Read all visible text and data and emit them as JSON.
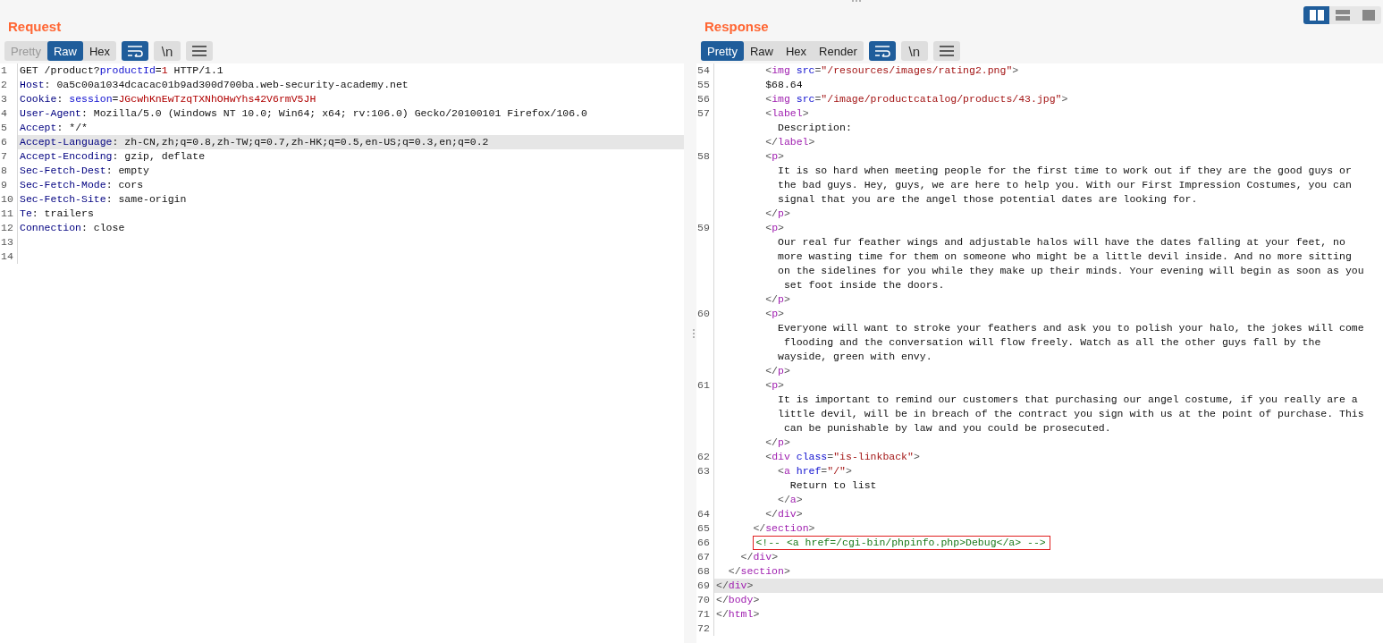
{
  "layout_buttons": [
    {
      "kind": "side-by-side",
      "selected": true
    },
    {
      "kind": "stacked",
      "selected": false
    },
    {
      "kind": "single",
      "selected": false
    }
  ],
  "request": {
    "title": "Request",
    "view_tabs": [
      {
        "label": "Pretty",
        "selected": false,
        "disabled": true
      },
      {
        "label": "Raw",
        "selected": true,
        "disabled": false
      },
      {
        "label": "Hex",
        "selected": false,
        "disabled": false
      }
    ],
    "tools": [
      {
        "kind": "wrap",
        "on": true
      },
      {
        "kind": "newline",
        "label": "\\n",
        "on": false
      },
      {
        "kind": "menu",
        "on": false
      }
    ],
    "lines": [
      {
        "number": "1",
        "current": false,
        "segs": [
          {
            "kind": "plain",
            "text": "GET /product?"
          },
          {
            "kind": "param",
            "text": "productId"
          },
          {
            "kind": "plain",
            "text": "="
          },
          {
            "kind": "value",
            "text": "1"
          },
          {
            "kind": "plain",
            "text": " HTTP/1.1"
          }
        ]
      },
      {
        "number": "2",
        "current": false,
        "segs": [
          {
            "kind": "header",
            "text": "Host"
          },
          {
            "kind": "plain",
            "text": ": 0a5c00a1034dcacac01b9ad300d700ba.web-security-academy.net"
          }
        ]
      },
      {
        "number": "3",
        "current": false,
        "segs": [
          {
            "kind": "header",
            "text": "Cookie"
          },
          {
            "kind": "plain",
            "text": ": "
          },
          {
            "kind": "param",
            "text": "session"
          },
          {
            "kind": "plain",
            "text": "="
          },
          {
            "kind": "value",
            "text": "JGcwhKnEwTzqTXNhOHwYhs42V6rmV5JH"
          }
        ]
      },
      {
        "number": "4",
        "current": false,
        "segs": [
          {
            "kind": "header",
            "text": "User-Agent"
          },
          {
            "kind": "plain",
            "text": ": Mozilla/5.0 (Windows NT 10.0; Win64; x64; rv:106.0) Gecko/20100101 Firefox/106.0"
          }
        ]
      },
      {
        "number": "5",
        "current": false,
        "segs": [
          {
            "kind": "header",
            "text": "Accept"
          },
          {
            "kind": "plain",
            "text": ": */*"
          }
        ]
      },
      {
        "number": "6",
        "current": true,
        "segs": [
          {
            "kind": "header",
            "text": "Accept-Language"
          },
          {
            "kind": "plain",
            "text": ": zh-CN,zh;q=0.8,zh-TW;q=0.7,zh-HK;q=0.5,en-US;q=0.3,en;q=0.2"
          }
        ]
      },
      {
        "number": "7",
        "current": false,
        "segs": [
          {
            "kind": "header",
            "text": "Accept-Encoding"
          },
          {
            "kind": "plain",
            "text": ": gzip, deflate"
          }
        ]
      },
      {
        "number": "8",
        "current": false,
        "segs": [
          {
            "kind": "header",
            "text": "Sec-Fetch-Dest"
          },
          {
            "kind": "plain",
            "text": ": empty"
          }
        ]
      },
      {
        "number": "9",
        "current": false,
        "segs": [
          {
            "kind": "header",
            "text": "Sec-Fetch-Mode"
          },
          {
            "kind": "plain",
            "text": ": cors"
          }
        ]
      },
      {
        "number": "10",
        "current": false,
        "segs": [
          {
            "kind": "header",
            "text": "Sec-Fetch-Site"
          },
          {
            "kind": "plain",
            "text": ": same-origin"
          }
        ]
      },
      {
        "number": "11",
        "current": false,
        "segs": [
          {
            "kind": "header",
            "text": "Te"
          },
          {
            "kind": "plain",
            "text": ": trailers"
          }
        ]
      },
      {
        "number": "12",
        "current": false,
        "segs": [
          {
            "kind": "header",
            "text": "Connection"
          },
          {
            "kind": "plain",
            "text": ": close"
          }
        ]
      },
      {
        "number": "13",
        "current": false
      },
      {
        "number": "14",
        "current": false
      }
    ]
  },
  "response": {
    "title": "Response",
    "view_tabs": [
      {
        "label": "Pretty",
        "selected": true,
        "disabled": false
      },
      {
        "label": "Raw",
        "selected": false,
        "disabled": false
      },
      {
        "label": "Hex",
        "selected": false,
        "disabled": false
      },
      {
        "label": "Render",
        "selected": false,
        "disabled": false
      }
    ],
    "tools": [
      {
        "kind": "wrap",
        "on": true
      },
      {
        "kind": "newline",
        "label": "\\n",
        "on": false
      },
      {
        "kind": "menu",
        "on": false
      }
    ],
    "lines": [
      {
        "number": "54",
        "current": false,
        "segs": [
          {
            "kind": "punct",
            "text": "        <"
          },
          {
            "kind": "tag",
            "text": "img"
          },
          {
            "kind": "attr",
            "text": " src"
          },
          {
            "kind": "punct",
            "text": "="
          },
          {
            "kind": "string",
            "text": "\"/resources/images/rating2.png\""
          },
          {
            "kind": "punct",
            "text": ">"
          }
        ]
      },
      {
        "number": "55",
        "current": false,
        "segs": [
          {
            "kind": "plain",
            "text": "        $68.64"
          }
        ]
      },
      {
        "number": "56",
        "current": false,
        "segs": [
          {
            "kind": "punct",
            "text": "        <"
          },
          {
            "kind": "tag",
            "text": "img"
          },
          {
            "kind": "attr",
            "text": " src"
          },
          {
            "kind": "punct",
            "text": "="
          },
          {
            "kind": "string",
            "text": "\"/image/productcatalog/products/43.jpg\""
          },
          {
            "kind": "punct",
            "text": ">"
          }
        ]
      },
      {
        "number": "57",
        "current": false,
        "segs": [
          {
            "kind": "punct",
            "text": "        <"
          },
          {
            "kind": "tag",
            "text": "label"
          },
          {
            "kind": "punct",
            "text": ">"
          }
        ]
      },
      {
        "current": false,
        "segs": [
          {
            "kind": "plain",
            "text": "          Description:"
          }
        ]
      },
      {
        "current": false,
        "segs": [
          {
            "kind": "punct",
            "text": "        </"
          },
          {
            "kind": "tag",
            "text": "label"
          },
          {
            "kind": "punct",
            "text": ">"
          }
        ]
      },
      {
        "number": "58",
        "current": false,
        "segs": [
          {
            "kind": "punct",
            "text": "        <"
          },
          {
            "kind": "tag",
            "text": "p"
          },
          {
            "kind": "punct",
            "text": ">"
          }
        ]
      },
      {
        "current": false,
        "segs": [
          {
            "kind": "plain",
            "text": "          It is so hard when meeting people for the first time to work out if they are the good guys or"
          }
        ]
      },
      {
        "current": false,
        "segs": [
          {
            "kind": "plain",
            "text": "          the bad guys. Hey, guys, we are here to help you. With our First Impression Costumes, you can"
          }
        ]
      },
      {
        "current": false,
        "segs": [
          {
            "kind": "plain",
            "text": "          signal that you are the angel those potential dates are looking for."
          }
        ]
      },
      {
        "current": false,
        "segs": [
          {
            "kind": "punct",
            "text": "        </"
          },
          {
            "kind": "tag",
            "text": "p"
          },
          {
            "kind": "punct",
            "text": ">"
          }
        ]
      },
      {
        "number": "59",
        "current": false,
        "segs": [
          {
            "kind": "punct",
            "text": "        <"
          },
          {
            "kind": "tag",
            "text": "p"
          },
          {
            "kind": "punct",
            "text": ">"
          }
        ]
      },
      {
        "current": false,
        "segs": [
          {
            "kind": "plain",
            "text": "          Our real fur feather wings and adjustable halos will have the dates falling at your feet, no"
          }
        ]
      },
      {
        "current": false,
        "segs": [
          {
            "kind": "plain",
            "text": "          more wasting time for them on someone who might be a little devil inside. And no more sitting"
          }
        ]
      },
      {
        "current": false,
        "segs": [
          {
            "kind": "plain",
            "text": "          on the sidelines for you while they make up their minds. Your evening will begin as soon as you"
          }
        ]
      },
      {
        "current": false,
        "segs": [
          {
            "kind": "plain",
            "text": "           set foot inside the doors."
          }
        ]
      },
      {
        "current": false,
        "segs": [
          {
            "kind": "punct",
            "text": "        </"
          },
          {
            "kind": "tag",
            "text": "p"
          },
          {
            "kind": "punct",
            "text": ">"
          }
        ]
      },
      {
        "number": "60",
        "current": false,
        "segs": [
          {
            "kind": "punct",
            "text": "        <"
          },
          {
            "kind": "tag",
            "text": "p"
          },
          {
            "kind": "punct",
            "text": ">"
          }
        ]
      },
      {
        "current": false,
        "segs": [
          {
            "kind": "plain",
            "text": "          Everyone will want to stroke your feathers and ask you to polish your halo, the jokes will come"
          }
        ]
      },
      {
        "current": false,
        "segs": [
          {
            "kind": "plain",
            "text": "           flooding and the conversation will flow freely. Watch as all the other guys fall by the"
          }
        ]
      },
      {
        "current": false,
        "segs": [
          {
            "kind": "plain",
            "text": "          wayside, green with envy."
          }
        ]
      },
      {
        "current": false,
        "segs": [
          {
            "kind": "punct",
            "text": "        </"
          },
          {
            "kind": "tag",
            "text": "p"
          },
          {
            "kind": "punct",
            "text": ">"
          }
        ]
      },
      {
        "number": "61",
        "current": false,
        "segs": [
          {
            "kind": "punct",
            "text": "        <"
          },
          {
            "kind": "tag",
            "text": "p"
          },
          {
            "kind": "punct",
            "text": ">"
          }
        ]
      },
      {
        "current": false,
        "segs": [
          {
            "kind": "plain",
            "text": "          It is important to remind our customers that purchasing our angel costume, if you really are a"
          }
        ]
      },
      {
        "current": false,
        "segs": [
          {
            "kind": "plain",
            "text": "          little devil, will be in breach of the contract you sign with us at the point of purchase. This"
          }
        ]
      },
      {
        "current": false,
        "segs": [
          {
            "kind": "plain",
            "text": "           can be punishable by law and you could be prosecuted."
          }
        ]
      },
      {
        "current": false,
        "segs": [
          {
            "kind": "punct",
            "text": "        </"
          },
          {
            "kind": "tag",
            "text": "p"
          },
          {
            "kind": "punct",
            "text": ">"
          }
        ]
      },
      {
        "number": "62",
        "current": false,
        "segs": [
          {
            "kind": "punct",
            "text": "        <"
          },
          {
            "kind": "tag",
            "text": "div"
          },
          {
            "kind": "attr",
            "text": " class"
          },
          {
            "kind": "punct",
            "text": "="
          },
          {
            "kind": "string",
            "text": "\"is-linkback\""
          },
          {
            "kind": "punct",
            "text": ">"
          }
        ]
      },
      {
        "number": "63",
        "current": false,
        "segs": [
          {
            "kind": "punct",
            "text": "          <"
          },
          {
            "kind": "tag",
            "text": "a"
          },
          {
            "kind": "attr",
            "text": " href"
          },
          {
            "kind": "punct",
            "text": "="
          },
          {
            "kind": "string",
            "text": "\"/\""
          },
          {
            "kind": "punct",
            "text": ">"
          }
        ]
      },
      {
        "current": false,
        "segs": [
          {
            "kind": "plain",
            "text": "            Return to list"
          }
        ]
      },
      {
        "current": false,
        "segs": [
          {
            "kind": "punct",
            "text": "          </"
          },
          {
            "kind": "tag",
            "text": "a"
          },
          {
            "kind": "punct",
            "text": ">"
          }
        ]
      },
      {
        "number": "64",
        "current": false,
        "segs": [
          {
            "kind": "punct",
            "text": "        </"
          },
          {
            "kind": "tag",
            "text": "div"
          },
          {
            "kind": "punct",
            "text": ">"
          }
        ]
      },
      {
        "number": "65",
        "current": false,
        "segs": [
          {
            "kind": "punct",
            "text": "      </"
          },
          {
            "kind": "tag",
            "text": "section"
          },
          {
            "kind": "punct",
            "text": ">"
          }
        ]
      },
      {
        "number": "66",
        "current": false,
        "segs": [
          {
            "kind": "flagged-comment",
            "text": "      <!-- <a href=/cgi-bin/phpinfo.php>Debug</a> -->"
          }
        ]
      },
      {
        "number": "67",
        "current": false,
        "segs": [
          {
            "kind": "punct",
            "text": "    </"
          },
          {
            "kind": "tag",
            "text": "div"
          },
          {
            "kind": "punct",
            "text": ">"
          }
        ]
      },
      {
        "number": "68",
        "current": false,
        "segs": [
          {
            "kind": "punct",
            "text": "  </"
          },
          {
            "kind": "tag",
            "text": "section"
          },
          {
            "kind": "punct",
            "text": ">"
          }
        ]
      },
      {
        "number": "69",
        "current": true,
        "segs": [
          {
            "kind": "punct",
            "text": "</"
          },
          {
            "kind": "tag",
            "text": "div"
          },
          {
            "kind": "punct",
            "text": ">"
          }
        ]
      },
      {
        "number": "70",
        "current": false,
        "segs": [
          {
            "kind": "punct",
            "text": "</"
          },
          {
            "kind": "tag",
            "text": "body"
          },
          {
            "kind": "punct",
            "text": ">"
          }
        ]
      },
      {
        "number": "71",
        "current": false,
        "segs": [
          {
            "kind": "punct",
            "text": "</"
          },
          {
            "kind": "tag",
            "text": "html"
          },
          {
            "kind": "punct",
            "text": ">"
          }
        ]
      },
      {
        "number": "72",
        "current": false
      }
    ]
  }
}
